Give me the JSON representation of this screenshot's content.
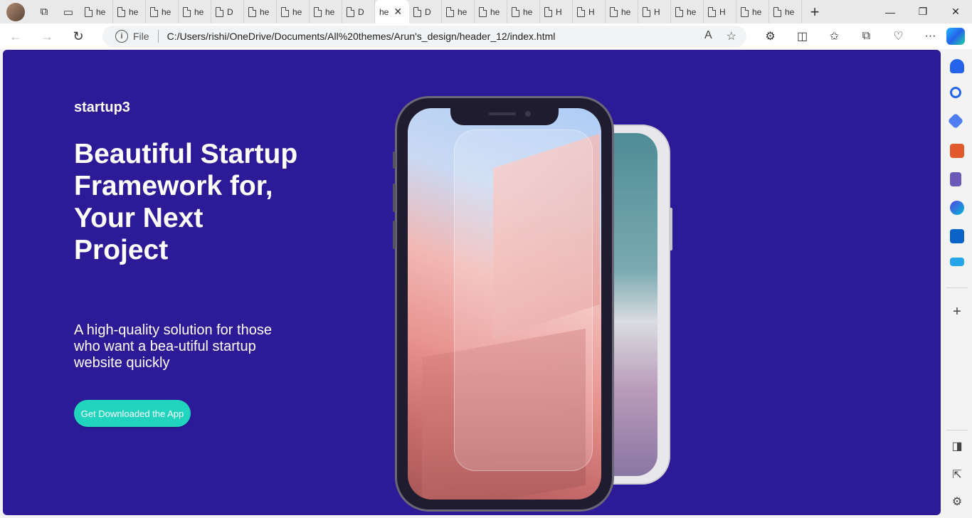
{
  "browser": {
    "tabs": [
      {
        "label": "he"
      },
      {
        "label": "he"
      },
      {
        "label": "he"
      },
      {
        "label": "he"
      },
      {
        "label": "D"
      },
      {
        "label": "he"
      },
      {
        "label": "he"
      },
      {
        "label": "he"
      },
      {
        "label": "D"
      },
      {
        "label": "he",
        "active": true
      },
      {
        "label": "D"
      },
      {
        "label": "he"
      },
      {
        "label": "he"
      },
      {
        "label": "he"
      },
      {
        "label": "H"
      },
      {
        "label": "H"
      },
      {
        "label": "he"
      },
      {
        "label": "H"
      },
      {
        "label": "he"
      },
      {
        "label": "H"
      },
      {
        "label": "he"
      },
      {
        "label": "he"
      }
    ],
    "address": {
      "scheme_label": "File",
      "url": "C:/Users/rishi/OneDrive/Documents/All%20themes/Arun's_design/header_12/index.html"
    }
  },
  "page": {
    "brand": "startup3",
    "title": "Beautiful Startup Framework for, Your Next Project",
    "subtitle": "A high-quality solution for those who want a bea-utiful startup website quickly",
    "cta_label": "Get Downloaded the App"
  },
  "colors": {
    "hero_background": "#2d1a97",
    "cta_background": "#21d4be"
  }
}
